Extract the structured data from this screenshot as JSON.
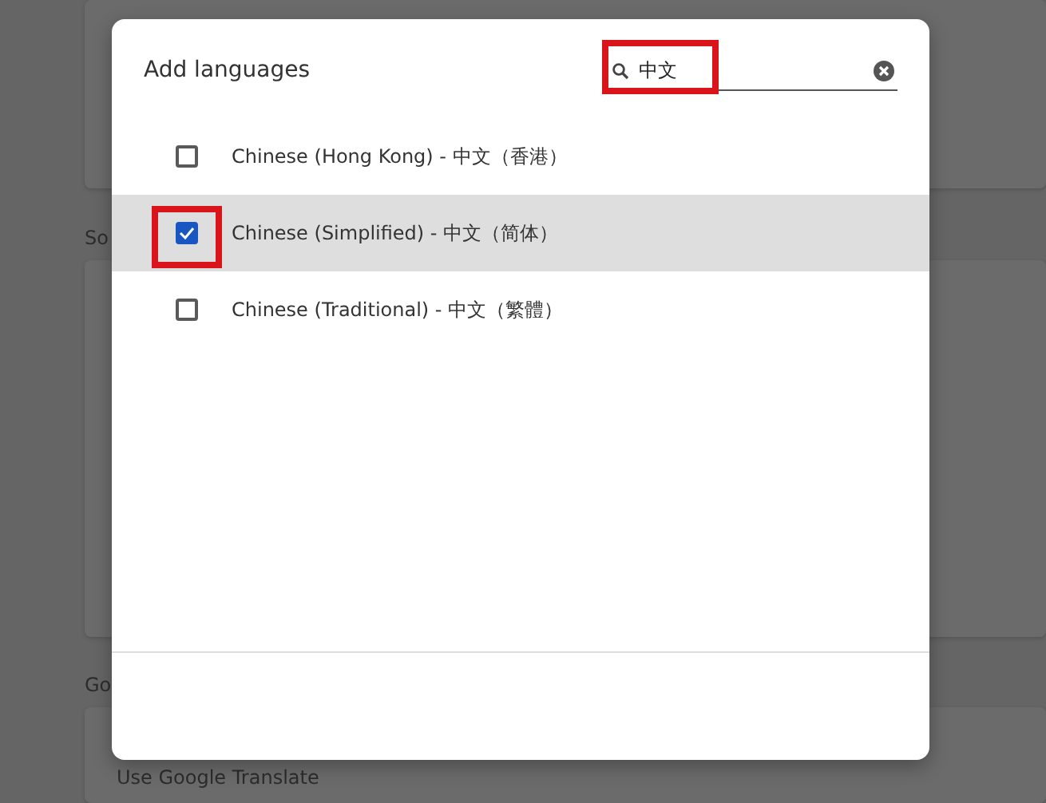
{
  "background": {
    "section_labels": [
      "So",
      "Go"
    ],
    "setting_row": "Use Google Translate"
  },
  "dialog": {
    "title": "Add languages",
    "search": {
      "value": "中文",
      "highlighted": true
    },
    "languages": [
      {
        "label": "Chinese (Hong Kong) - 中文（香港）",
        "checked": false,
        "selected": false,
        "highlighted": false
      },
      {
        "label": "Chinese (Simplified) - 中文（简体）",
        "checked": true,
        "selected": true,
        "highlighted": true
      },
      {
        "label": "Chinese (Traditional) - 中文（繁體）",
        "checked": false,
        "selected": false,
        "highlighted": false
      }
    ]
  }
}
